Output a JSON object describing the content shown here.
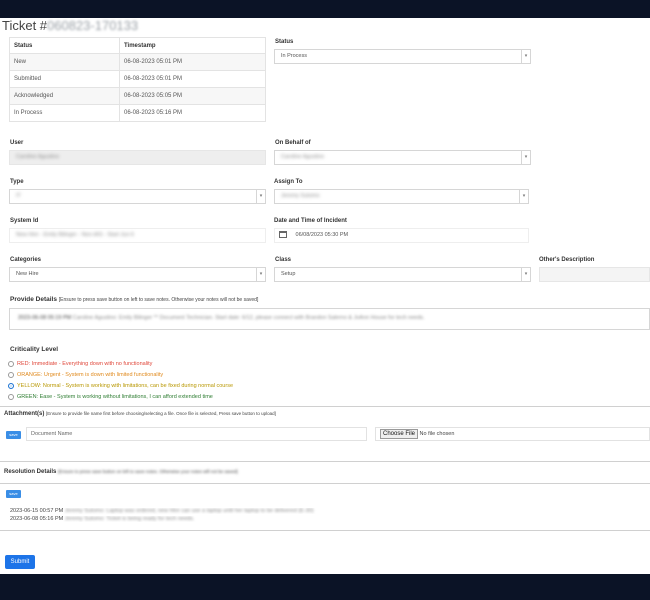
{
  "ticket": {
    "title_prefix": "Ticket #",
    "title_id": "060823-170133"
  },
  "status_table": {
    "headers": [
      "Status",
      "Timestamp"
    ],
    "rows": [
      [
        "New",
        "06-08-2023 05:01 PM"
      ],
      [
        "Submitted",
        "06-08-2023 05:01 PM"
      ],
      [
        "Acknowledged",
        "06-08-2023 05:05 PM"
      ],
      [
        "In Process",
        "06-08-2023 05:16 PM"
      ]
    ]
  },
  "status_field": {
    "label": "Status",
    "value": "In Process"
  },
  "user_field": {
    "label": "User",
    "value": "Caroline Agustino"
  },
  "on_behalf_field": {
    "label": "On Behalf of",
    "value": "Caroline Agustino"
  },
  "type_field": {
    "label": "Type",
    "value": "IT"
  },
  "assign_to_field": {
    "label": "Assign To",
    "value": "Jeremy Sutomo"
  },
  "system_id_field": {
    "label": "System Id",
    "value": "New Hire - Emily Bilinger - Non-IAS - Start Jun 6"
  },
  "datetime_field": {
    "label": "Date and Time of Incident",
    "value": "06/08/2023 05:30 PM",
    "icon": "calendar-icon"
  },
  "categories_field": {
    "label": "Categories",
    "value": "New Hire"
  },
  "class_field": {
    "label": "Class",
    "value": "Setup"
  },
  "other_desc_field": {
    "label": "Other's Description",
    "value": ""
  },
  "provide_details": {
    "label": "Provide Details",
    "hint": "[Ensure to press save button on left to save notes. Otherwise your notes will not be saved]",
    "prefix": "2023-06-08 05:19 PM",
    "text": "Caroline Agustino: Emily Bilinger ** Document Technician. Start date: 6/12, please connect with Brandon Salerno & JoAnn House for tech needs."
  },
  "criticality": {
    "label": "Criticality Level",
    "options": [
      {
        "text": "RED: Immediate - Everything down with no functionality",
        "color": "#e0483b",
        "selected": false
      },
      {
        "text": "ORANGE: Urgent - System is down with limited functionality",
        "color": "#e08a1e",
        "selected": false
      },
      {
        "text": "YELLOW: Normal - System is working with limitations, can be fixed during normal course",
        "color": "#c9a400",
        "selected": true
      },
      {
        "text": "GREEN: Ease - System is working without limitations, I can afford extended time",
        "color": "#2e7d32",
        "selected": false
      }
    ]
  },
  "attachments": {
    "label": "Attachment(s)",
    "hint": "[Ensure to provide file name first before choosing/selecting a file. Once file is selected, Press save button to upload]",
    "save_label": "save",
    "doc_placeholder": "Document Name",
    "choose_label": "Choose File",
    "no_file": "No file chosen"
  },
  "resolution": {
    "label": "Resolution Details",
    "hint": "[Ensure to press save button on left to save notes. Otherwise your notes will not be saved]",
    "save_label": "save",
    "entries": [
      {
        "prefix": "2023-06-15 00:57 PM",
        "text": "Jeremy Sutomo: Laptop was ordered, new Hire can use a laptop until her laptop to be delivered (E-30)"
      },
      {
        "prefix": "2023-06-08 05:16 PM",
        "text": "Jeremy Sutomo: Ticket is being ready for tech needs."
      }
    ]
  },
  "submit_label": "Submit"
}
